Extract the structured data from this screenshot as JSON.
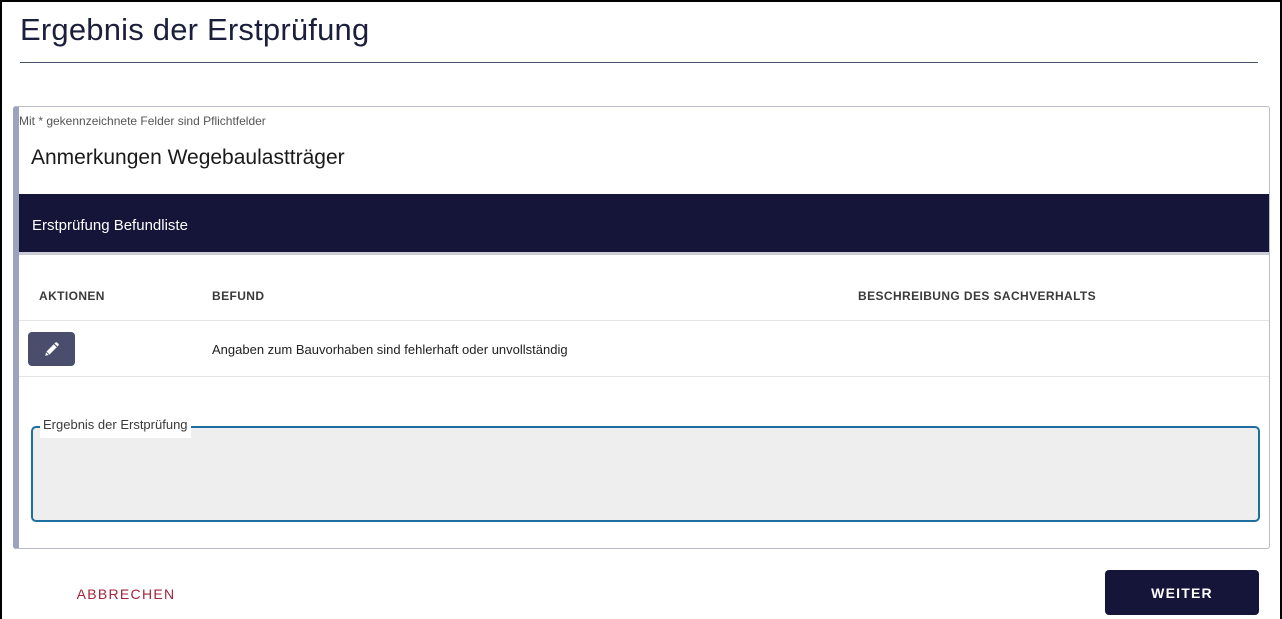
{
  "page": {
    "title": "Ergebnis der Erstprüfung"
  },
  "form": {
    "required_note": "Mit * gekennzeichnete Felder sind Pflichtfelder",
    "section_title": "Anmerkungen Wegebaulastträger"
  },
  "findings": {
    "header": "Erstprüfung Befundliste",
    "columns": [
      "AKTIONEN",
      "BEFUND",
      "BESCHREIBUNG DES SACHVERHALTS"
    ],
    "rows": [
      {
        "befund": "Angaben zum Bauvorhaben sind fehlerhaft oder unvollständig",
        "beschreibung": ""
      }
    ]
  },
  "result_field": {
    "label": "Ergebnis der Erstprüfung",
    "value": ""
  },
  "actions": {
    "cancel": "ABBRECHEN",
    "next": "WEITER"
  },
  "colors": {
    "primary": "#15153a",
    "edit_button": "#4a4d6b",
    "focus_border": "#1e6fa0",
    "cancel_text": "#a3243b"
  },
  "icons": {
    "edit": "pencil-icon"
  }
}
